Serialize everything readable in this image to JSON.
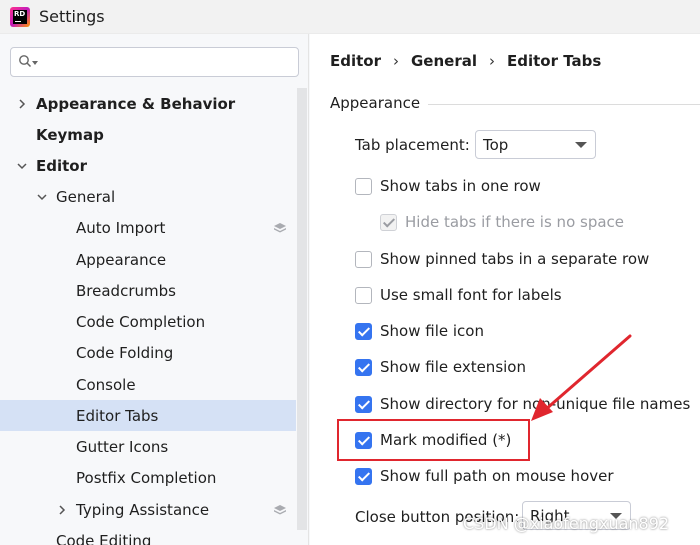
{
  "window": {
    "title": "Settings",
    "app_icon_text": "RD"
  },
  "search": {
    "placeholder": "",
    "value": ""
  },
  "tree": [
    {
      "label": "Appearance & Behavior",
      "bold": true,
      "expander": "collapsed"
    },
    {
      "label": "Keymap",
      "bold": true
    },
    {
      "label": "Editor",
      "bold": true,
      "expander": "expanded"
    },
    {
      "label": "General",
      "expander": "expanded"
    },
    {
      "label": "Auto Import",
      "project_icon": true
    },
    {
      "label": "Appearance"
    },
    {
      "label": "Breadcrumbs"
    },
    {
      "label": "Code Completion"
    },
    {
      "label": "Code Folding"
    },
    {
      "label": "Console"
    },
    {
      "label": "Editor Tabs",
      "selected": true
    },
    {
      "label": "Gutter Icons"
    },
    {
      "label": "Postfix Completion"
    },
    {
      "label": "Typing Assistance",
      "expander": "collapsed",
      "project_icon": true
    },
    {
      "label": "Code Editing"
    }
  ],
  "breadcrumb": [
    "Editor",
    "General",
    "Editor Tabs"
  ],
  "breadcrumb_separator": "›",
  "section": {
    "title": "Appearance"
  },
  "tab_placement": {
    "label": "Tab placement:",
    "value": "Top"
  },
  "options": [
    {
      "label": "Show tabs in one row",
      "checked": false
    },
    {
      "label": "Hide tabs if there is no space",
      "checked": true,
      "disabled": true
    },
    {
      "label": "Show pinned tabs in a separate row",
      "checked": false
    },
    {
      "label": "Use small font for labels",
      "checked": false
    },
    {
      "label": "Show file icon",
      "checked": true
    },
    {
      "label": "Show file extension",
      "checked": true
    },
    {
      "label": "Show directory for non-unique file names",
      "checked": true
    },
    {
      "label": "Mark modified (*)",
      "checked": true
    },
    {
      "label": "Show full path on mouse hover",
      "checked": true
    }
  ],
  "close_button": {
    "label": "Close button position:",
    "value": "Right"
  },
  "annotation": {
    "color": "#e0262e"
  },
  "colors": {
    "accent": "#3574f0",
    "selection": "#d5e1f5"
  },
  "watermark": "CSDN @xiaofengxuan892"
}
